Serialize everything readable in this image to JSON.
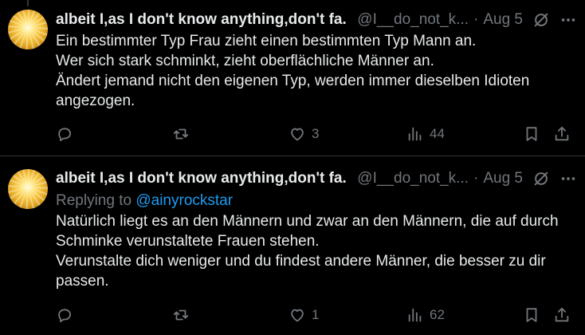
{
  "tweets": [
    {
      "author_name": "albeit I,as I don't know anything,don't fa...",
      "handle": "@I__do_not_k...",
      "separator": "·",
      "date": "Aug 5",
      "replying_prefix": "",
      "replying_to": "",
      "lines": [
        "Ein bestimmter Typ Frau zieht einen bestimmten Typ Mann an.",
        "Wer sich stark schminkt, zieht oberflächliche  Männer an.",
        "Ändert jemand nicht den eigenen Typ, werden immer dieselben Idioten",
        "angezogen."
      ],
      "reply_count": "",
      "retweet_count": "",
      "like_count": "3",
      "view_count": "44"
    },
    {
      "author_name": "albeit I,as I don't know anything,don't fa...",
      "handle": "@I__do_not_k...",
      "separator": "·",
      "date": "Aug 5",
      "replying_prefix": "Replying to ",
      "replying_to": "@ainyrockstar",
      "lines": [
        "Natürlich liegt es an den Männern und zwar an den Männern, die auf durch",
        "Schminke verunstaltete Frauen stehen.",
        "Verunstalte dich weniger und du findest andere Männer, die besser zu dir",
        "passen."
      ],
      "reply_count": "",
      "retweet_count": "",
      "like_count": "1",
      "view_count": "62"
    }
  ],
  "colors": {
    "background": "#000000",
    "text": "#e7e9ea",
    "muted": "#71767b",
    "link": "#1d9bf0",
    "divider": "#2f3336"
  },
  "icons": [
    "reply-icon",
    "retweet-icon",
    "like-icon",
    "views-icon",
    "bookmark-icon",
    "share-icon",
    "grok-icon",
    "more-icon"
  ]
}
